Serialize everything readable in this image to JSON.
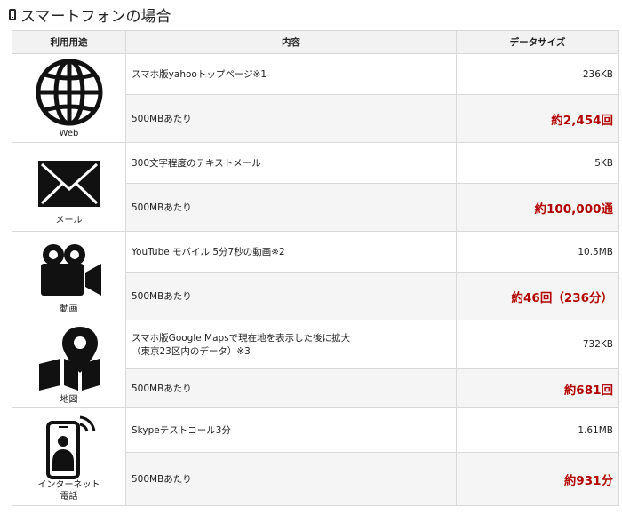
{
  "heading": {
    "icon": "smartphone-icon",
    "title": "スマートフォンの場合"
  },
  "table": {
    "headers": {
      "usage": "利用用途",
      "content": "内容",
      "size": "データサイズ"
    },
    "rows": [
      {
        "icon": "globe-icon",
        "label": "Web",
        "item": "スマホ版yahooトップページ※1",
        "size": "236KB",
        "per": "500MBあたり",
        "result": "約2,454回"
      },
      {
        "icon": "envelope-icon",
        "label": "メール",
        "item": "300文字程度のテキストメール",
        "size": "5KB",
        "per": "500MBあたり",
        "result": "約100,000通"
      },
      {
        "icon": "video-camera-icon",
        "label": "動画",
        "item": "YouTube モバイル 5分7秒の動画※2",
        "size": "10.5MB",
        "per": "500MBあたり",
        "result": "約46回（236分）"
      },
      {
        "icon": "map-pin-icon",
        "label": "地図",
        "item": "スマホ版Google Mapsで現在地を表示した後に拡大",
        "item_line2": "（東京23区内のデータ）※3",
        "size": "732KB",
        "per": "500MBあたり",
        "result": "約681回"
      },
      {
        "icon": "phone-call-icon",
        "label": "インターネット",
        "label_line2": "電話",
        "item": "Skypeテストコール3分",
        "size": "1.61MB",
        "per": "500MBあたり",
        "result": "約931分"
      }
    ]
  }
}
